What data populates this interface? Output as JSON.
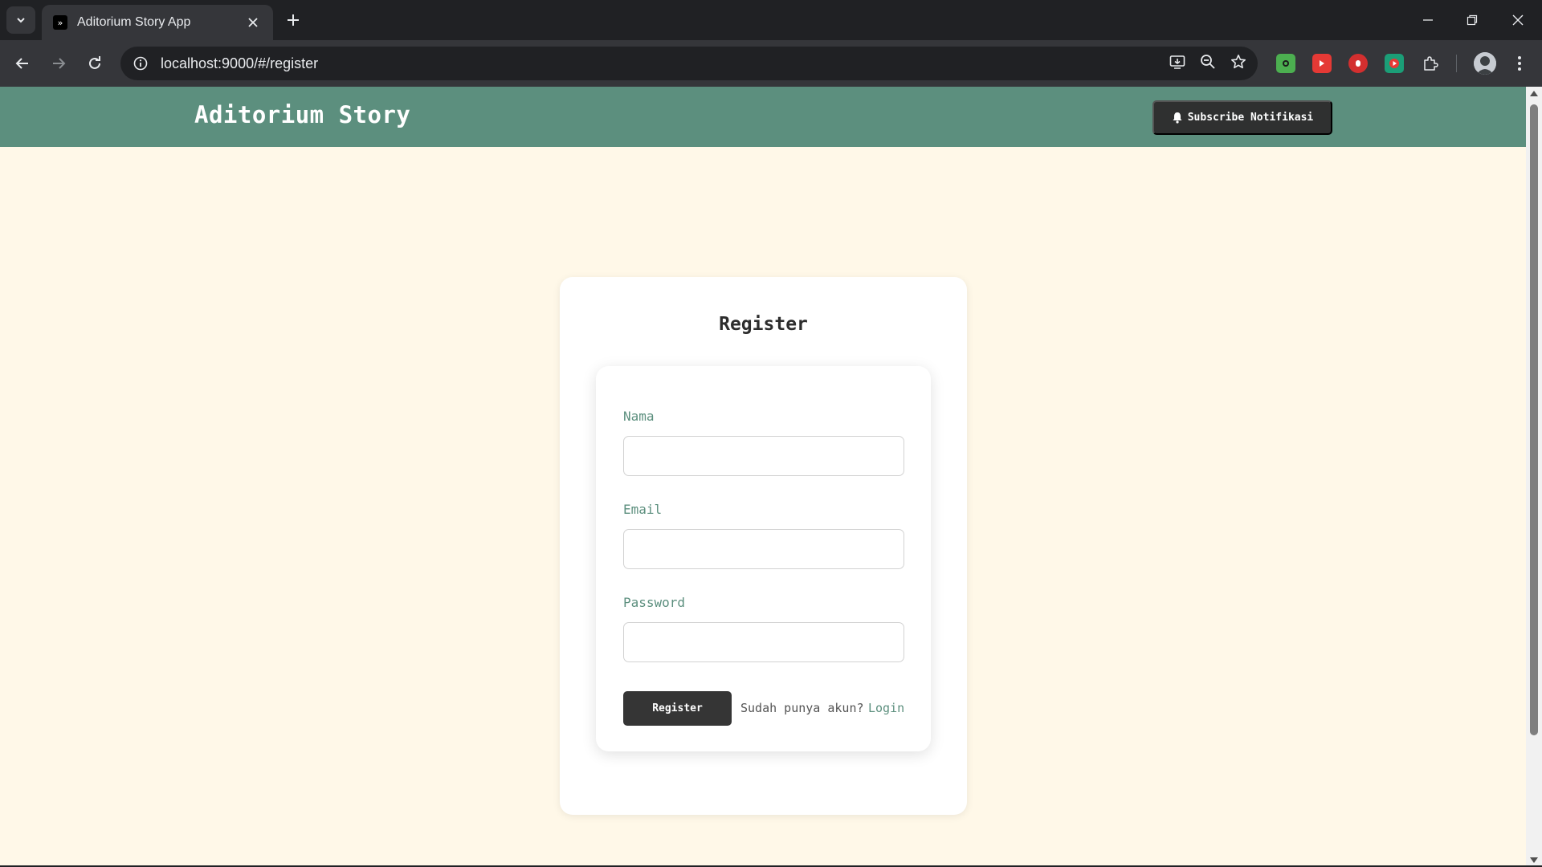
{
  "browser": {
    "tab_title": "Aditorium Story App",
    "url": "localhost:9000/#/register",
    "icons": {
      "tab_list": "chevron-down-icon",
      "close_tab": "close-icon",
      "new_tab": "plus-icon",
      "back": "arrow-left-icon",
      "forward": "arrow-right-icon",
      "reload": "reload-icon",
      "site_info": "info-icon",
      "install": "install-app-icon",
      "zoom": "zoom-out-icon",
      "bookmark": "star-icon",
      "extensions": "puzzle-icon",
      "menu": "more-vertical-icon"
    }
  },
  "app": {
    "brand": "Aditorium Story",
    "subscribe_label": "Subscribe Notifikasi",
    "accent_color": "#5c8f7e",
    "background_color": "#fff8e8"
  },
  "register": {
    "title": "Register",
    "fields": {
      "name_label": "Nama",
      "email_label": "Email",
      "password_label": "Password",
      "name_value": "",
      "email_value": "",
      "password_value": ""
    },
    "submit_label": "Register",
    "have_account_text": "Sudah punya akun?",
    "login_link": "Login"
  }
}
